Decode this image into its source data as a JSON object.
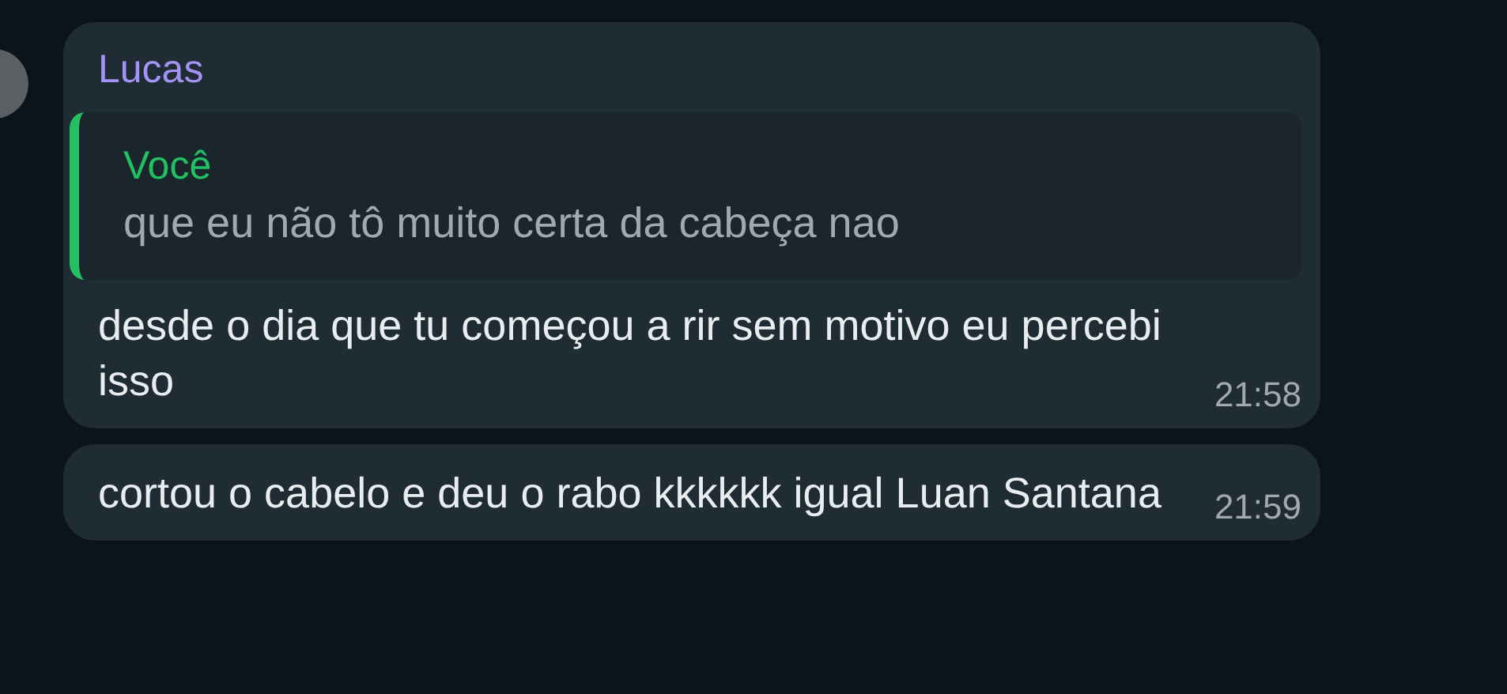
{
  "messages": [
    {
      "sender": "Lucas",
      "quote": {
        "author": "Você",
        "text": "que eu não tô muito certa da cabeça nao"
      },
      "text": "desde o dia que tu começou a rir sem motivo eu percebi isso",
      "time": "21:58"
    },
    {
      "text": "cortou o cabelo e deu o rabo kkkkkk igual Luan Santana",
      "time": "21:59"
    }
  ]
}
